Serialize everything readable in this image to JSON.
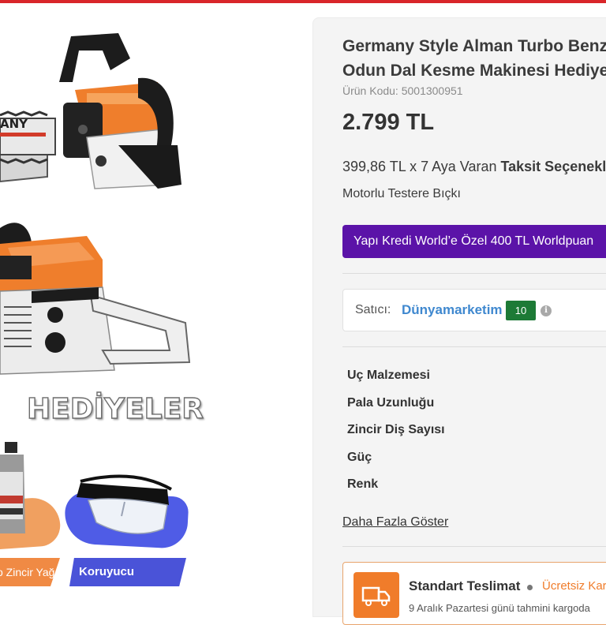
{
  "product": {
    "title_line1": "Germany Style Alman Turbo Benzinli",
    "title_line2": "Odun Dal Kesme Makinesi Hediyeli",
    "code": "Ürün Kodu: 5001300951",
    "price": "2.799 TL",
    "installment_prefix": "399,86 TL x 7 Aya Varan ",
    "installment_bold": "Taksit Seçenekleri",
    "category": "Motorlu Testere Bıçkı",
    "promo": "Yapı Kredi World’e Özel 400 TL Worldpuan"
  },
  "gallery": {
    "saw_logo_text": "ANY",
    "gifts_title": "HEDİYELER",
    "tag_oil": "o Zincir Yağı",
    "tag_glasses": "Koruyucu Gözlük"
  },
  "seller": {
    "label": "Satıcı:",
    "name": "Dünyamarketim",
    "score": "10",
    "info_icon": "i"
  },
  "specs": [
    "Uç Malzemesi",
    "Pala Uzunluğu",
    "Zincir Diş Sayısı",
    "Güç",
    "Renk"
  ],
  "more_link": "Daha Fazla Göster",
  "delivery": {
    "title": "Standart Teslimat",
    "free": "Ücretsiz Kargo",
    "date": "9 Aralık Pazartesi günü tahmini kargoda"
  },
  "colors": {
    "top_bar": "#d9262a",
    "promo_purple": "#5b13a8",
    "seller_blue": "#3f88cf",
    "score_green": "#1d7a36",
    "delivery_orange": "#f07c2a",
    "oil_tag": "#f08a44",
    "glasses_tag": "#4a53d8"
  }
}
